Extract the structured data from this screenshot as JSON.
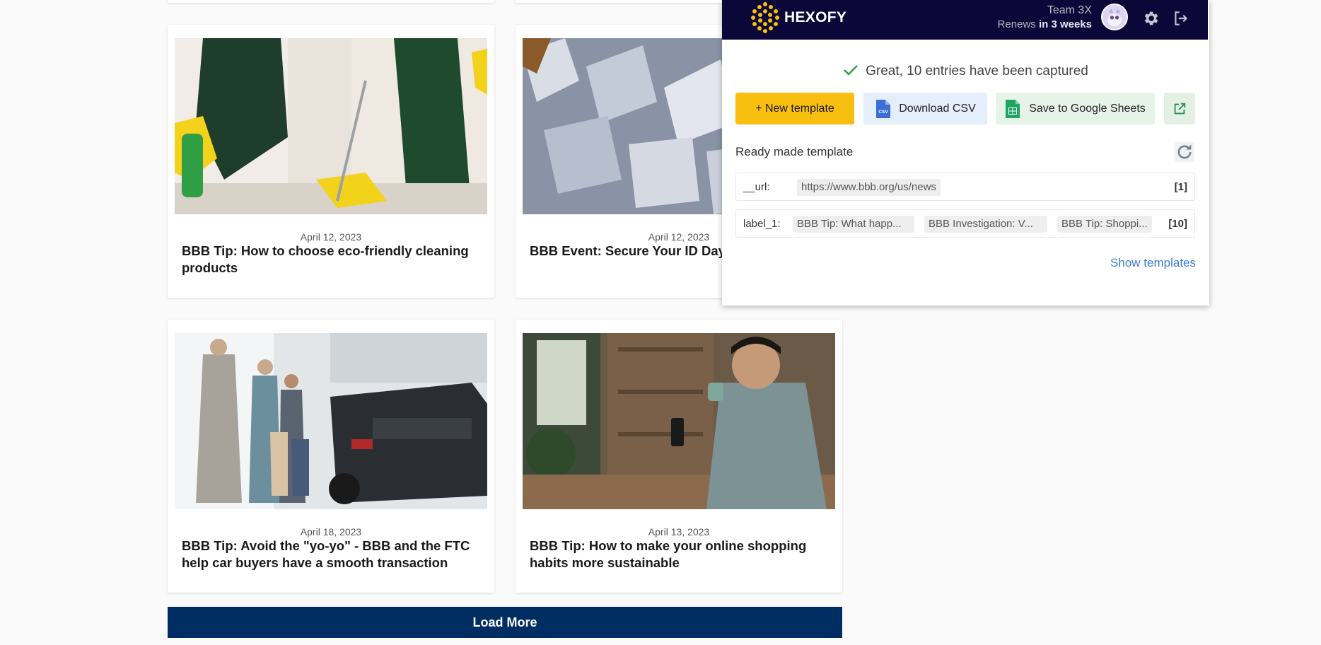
{
  "articles": [
    {
      "date": "April 12, 2023",
      "title": "BBB Tip: How to choose eco-friendly cleaning products"
    },
    {
      "date": "April 12, 2023",
      "title": "BBB Event: Secure Your ID Day"
    },
    {
      "date": "April 18, 2023",
      "title": "BBB Tip: Avoid the \"yo-yo\" - BBB and the FTC help car buyers have a smooth transaction"
    },
    {
      "date": "April 13, 2023",
      "title": "BBB Tip: How to make your online shopping habits more sustainable"
    }
  ],
  "load_more_label": "Load More",
  "hexofy": {
    "brand": "HEXOFY",
    "team": "Team 3X",
    "renews_prefix": "Renews ",
    "renews_when": "in 3 weeks",
    "status": "Great, 10 entries have been captured",
    "buttons": {
      "new_template": "+ New template",
      "download_csv": "Download CSV",
      "csv_badge": "CSV",
      "save_sheets": "Save to Google Sheets"
    },
    "section_label": "Ready made template",
    "rows": [
      {
        "label": "__url:",
        "values": [
          "https://www.bbb.org/us/news"
        ],
        "count": "[1]"
      },
      {
        "label": "label_1:",
        "values": [
          "BBB Tip: What happ...",
          "BBB Investigation: V...",
          "BBB Tip: Shoppi..."
        ],
        "count": "[10]"
      }
    ],
    "show_templates": "Show templates",
    "accent": "#f9bf10",
    "header_bg": "#0b0738",
    "link_color": "#3a7bd5"
  },
  "icons": [
    "hexofy-logo-icon",
    "avatar",
    "gear-icon",
    "logout-icon",
    "check-icon",
    "csv-file-icon",
    "google-sheets-icon",
    "external-link-icon",
    "refresh-icon"
  ]
}
